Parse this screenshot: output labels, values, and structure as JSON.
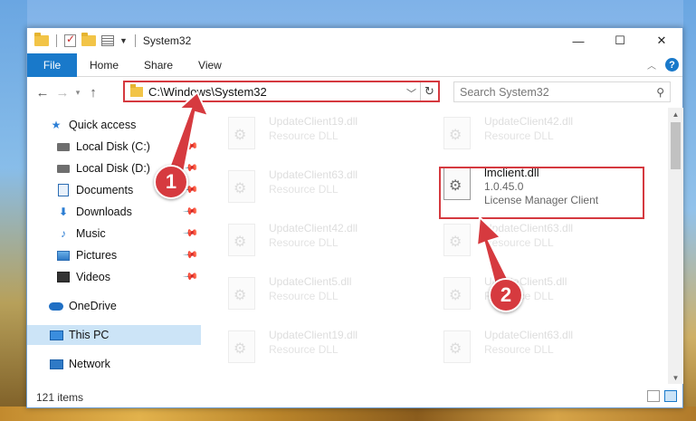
{
  "window": {
    "title": "System32",
    "caption": {
      "minimize": "—",
      "maximize": "☐",
      "close": "✕"
    }
  },
  "ribbon": {
    "file": "File",
    "tabs": [
      "Home",
      "Share",
      "View"
    ]
  },
  "address": {
    "path": "C:\\Windows\\System32",
    "search_placeholder": "Search System32"
  },
  "nav": {
    "quick_access": "Quick access",
    "items": [
      {
        "label": "Local Disk (C:)",
        "icon": "drive-icon",
        "pinned": true
      },
      {
        "label": "Local Disk (D:)",
        "icon": "drive-icon",
        "pinned": true
      },
      {
        "label": "Documents",
        "icon": "documents-icon",
        "pinned": true
      },
      {
        "label": "Downloads",
        "icon": "downloads-icon",
        "pinned": true
      },
      {
        "label": "Music",
        "icon": "music-icon",
        "pinned": true
      },
      {
        "label": "Pictures",
        "icon": "pictures-icon",
        "pinned": true
      },
      {
        "label": "Videos",
        "icon": "videos-icon",
        "pinned": true
      }
    ],
    "onedrive": "OneDrive",
    "this_pc": "This PC",
    "network": "Network"
  },
  "files": {
    "left": [
      {
        "name": "UpdateClient19.dll",
        "desc": "Resource DLL"
      },
      {
        "name": "UpdateClient63.dll",
        "desc": "Resource DLL"
      },
      {
        "name": "UpdateClient42.dll",
        "desc": "Resource DLL"
      },
      {
        "name": "UpdateClient5.dll",
        "desc": "Resource DLL"
      },
      {
        "name": "UpdateClient19.dll",
        "desc": "Resource DLL"
      }
    ],
    "right": [
      {
        "name": "UpdateClient42.dll",
        "desc": "Resource DLL"
      },
      {
        "name": "UpdateClient63.dll",
        "desc": "Resource DLL"
      },
      {
        "name": "UpdateClient5.dll",
        "desc": "Resource DLL"
      },
      {
        "name": "UpdateClient63.dll",
        "desc": "Resource DLL"
      }
    ],
    "highlighted": {
      "name": "lmclient.dll",
      "version": "1.0.45.0",
      "desc": "License Manager Client"
    }
  },
  "status": {
    "count": "121 items"
  },
  "callouts": {
    "one": "1",
    "two": "2"
  },
  "colors": {
    "accent": "#1979ca",
    "highlight": "#d5393f",
    "callout": "#d63a3f"
  }
}
